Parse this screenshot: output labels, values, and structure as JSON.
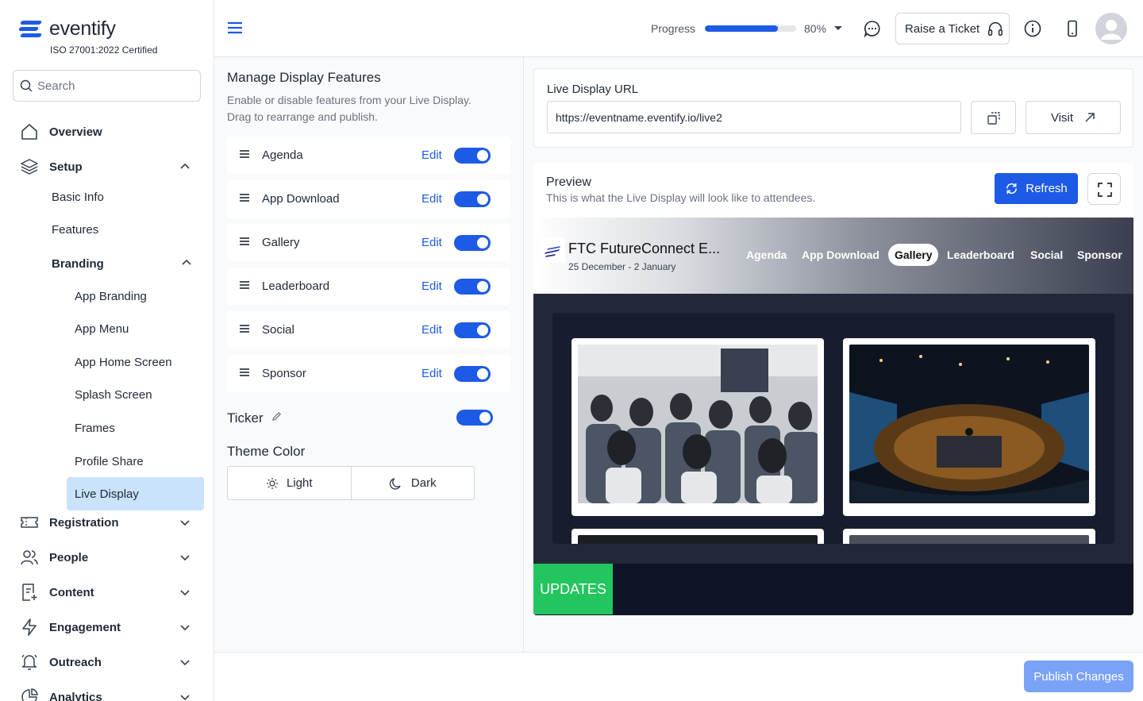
{
  "brand": {
    "name": "eventify",
    "certification": "ISO 27001:2022 Certified",
    "accent": "#1d5ae6"
  },
  "search": {
    "placeholder": "Search"
  },
  "sidebar": {
    "overview": "Overview",
    "setup": "Setup",
    "setup_items": [
      "Basic Info",
      "Features"
    ],
    "branding": "Branding",
    "branding_items": [
      "App Branding",
      "App Menu",
      "App Home Screen",
      "Splash Screen",
      "Frames",
      "Profile Share",
      "Live Display"
    ],
    "selected": "Live Display",
    "sections": [
      "Registration",
      "People",
      "Content",
      "Engagement",
      "Outreach",
      "Analytics"
    ]
  },
  "topbar": {
    "progress_label": "Progress",
    "progress_value": 0.8,
    "progress_text": "80%",
    "ticket_label": "Raise a Ticket"
  },
  "manage": {
    "title": "Manage Display Features",
    "description": "Enable or disable features from your Live Display. Drag to rearrange and publish.",
    "edit_label": "Edit",
    "features": [
      {
        "name": "Agenda",
        "enabled": true
      },
      {
        "name": "App Download",
        "enabled": true
      },
      {
        "name": "Gallery",
        "enabled": true
      },
      {
        "name": "Leaderboard",
        "enabled": true
      },
      {
        "name": "Social",
        "enabled": true
      },
      {
        "name": "Sponsor",
        "enabled": true
      }
    ],
    "ticker_label": "Ticker",
    "ticker_enabled": true,
    "theme_label": "Theme Color",
    "theme_options": [
      "Light",
      "Dark"
    ]
  },
  "url": {
    "label": "Live Display URL",
    "value": "https://eventname.eventify.io/live2",
    "visit_label": "Visit"
  },
  "preview": {
    "title": "Preview",
    "description": "This is what the Live Display will look like to attendees.",
    "refresh_label": "Refresh",
    "event_title": "FTC FutureConnect E...",
    "event_dates": "25 December - 2 January",
    "nav": [
      "Agenda",
      "App Download",
      "Gallery",
      "Leaderboard",
      "Social",
      "Sponsor"
    ],
    "active_nav": "Gallery",
    "updates_label": "UPDATES"
  },
  "footer": {
    "publish_label": "Publish Changes"
  }
}
